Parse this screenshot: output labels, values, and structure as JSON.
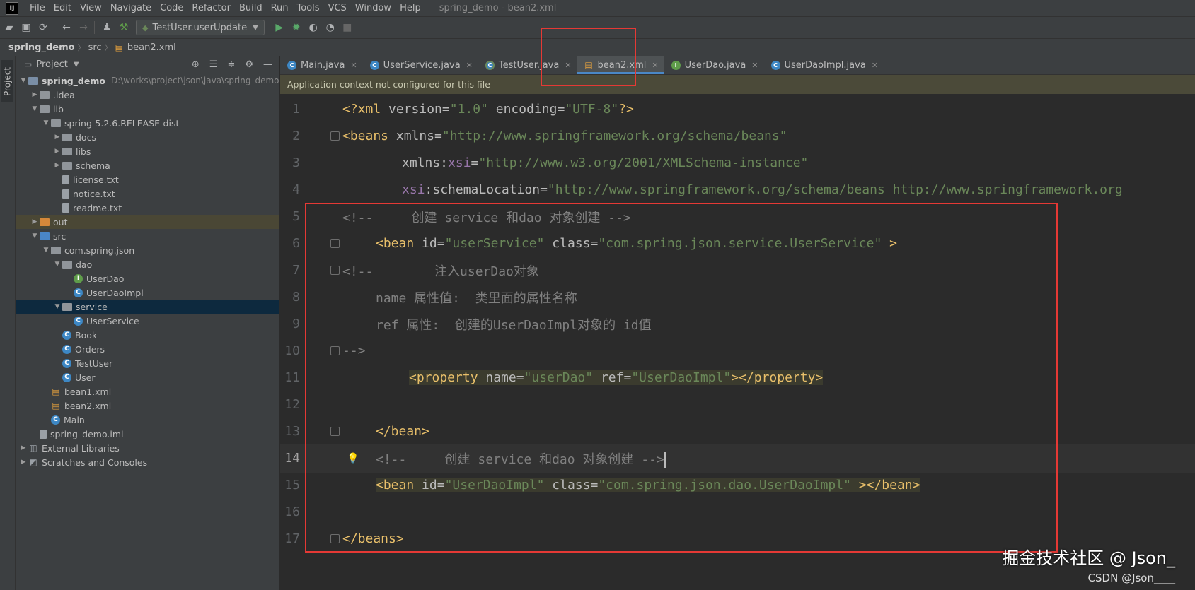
{
  "menubar": {
    "logo": "IJ",
    "items": [
      "File",
      "Edit",
      "View",
      "Navigate",
      "Code",
      "Refactor",
      "Build",
      "Run",
      "Tools",
      "VCS",
      "Window",
      "Help"
    ],
    "window_title": "spring_demo - bean2.xml"
  },
  "toolbar": {
    "run_config": "TestUser.userUpdate"
  },
  "breadcrumb": {
    "project": "spring_demo",
    "folder": "src",
    "file": "bean2.xml"
  },
  "left_strip": {
    "project_tab": "Project"
  },
  "project_panel": {
    "title": "Project",
    "tree": [
      {
        "label": "spring_demo",
        "path": "D:\\works\\project\\json\\java\\spring_demo"
      },
      {
        "label": ".idea"
      },
      {
        "label": "lib"
      },
      {
        "label": "spring-5.2.6.RELEASE-dist"
      },
      {
        "label": "docs"
      },
      {
        "label": "libs"
      },
      {
        "label": "schema"
      },
      {
        "label": "license.txt"
      },
      {
        "label": "notice.txt"
      },
      {
        "label": "readme.txt"
      },
      {
        "label": "out"
      },
      {
        "label": "src"
      },
      {
        "label": "com.spring.json"
      },
      {
        "label": "dao"
      },
      {
        "label": "UserDao"
      },
      {
        "label": "UserDaoImpl"
      },
      {
        "label": "service"
      },
      {
        "label": "UserService"
      },
      {
        "label": "Book"
      },
      {
        "label": "Orders"
      },
      {
        "label": "TestUser"
      },
      {
        "label": "User"
      },
      {
        "label": "bean1.xml"
      },
      {
        "label": "bean2.xml"
      },
      {
        "label": "Main"
      },
      {
        "label": "spring_demo.iml"
      },
      {
        "label": "External Libraries"
      },
      {
        "label": "Scratches and Consoles"
      }
    ]
  },
  "editor": {
    "tabs": [
      {
        "label": "Main.java"
      },
      {
        "label": "UserService.java"
      },
      {
        "label": "TestUser.java"
      },
      {
        "label": "bean2.xml"
      },
      {
        "label": "UserDao.java"
      },
      {
        "label": "UserDaoImpl.java"
      }
    ],
    "notification": "Application context not configured for this file",
    "line_numbers": [
      "1",
      "2",
      "3",
      "4",
      "5",
      "6",
      "7",
      "8",
      "9",
      "10",
      "11",
      "12",
      "13",
      "14",
      "15",
      "16",
      "17"
    ],
    "code": {
      "l1": {
        "a": "<?xml ",
        "b": "version",
        "c": "=",
        "d": "\"1.0\"",
        "e": " encoding",
        "f": "=",
        "g": "\"UTF-8\"",
        "h": "?>"
      },
      "l2": {
        "a": "<beans ",
        "b": "xmlns",
        "c": "=",
        "d": "\"http://www.springframework.org/schema/beans\""
      },
      "l3": {
        "a": "xmlns:",
        "b": "xsi",
        "c": "=",
        "d": "\"http://www.w3.org/2001/XMLSchema-instance\""
      },
      "l4": {
        "a": "xsi",
        "b": ":schemaLocation",
        "c": "=",
        "d": "\"http://www.springframework.org/schema/beans http://www.springframework.org"
      },
      "l5": "<!--     创建 service 和dao 对象创建 -->",
      "l6": {
        "a": "<bean ",
        "b": "id",
        "c": "=",
        "d": "\"userService\"",
        "e": " class",
        "f": "=",
        "g": "\"com.spring.json.service.UserService\"",
        "h": " >"
      },
      "l7": "<!--        注入userDao对象",
      "l8": "name 属性值:  类里面的属性名称",
      "l9": "ref 属性:  创建的UserDaoImpl对象的 id值",
      "l10": "-->",
      "l11": {
        "a": "<property ",
        "b": "name",
        "c": "=",
        "d": "\"userDao\"",
        "e": " ref",
        "f": "=",
        "g": "\"UserDaoImpl\"",
        "h": "></property>"
      },
      "l13": "</bean>",
      "l14": "<!--     创建 service 和dao 对象创建 -->",
      "l15": {
        "a": "<bean ",
        "b": "id",
        "c": "=",
        "d": "\"UserDaoImpl\"",
        "e": " class",
        "f": "=",
        "g": "\"com.spring.json.dao.UserDaoImpl\"",
        "h": " ></bean>"
      },
      "l17": "</beans>"
    }
  },
  "watermark": {
    "main": "掘金技术社区 @ Json_",
    "small": "CSDN @Json____"
  },
  "colors": {
    "annotation": "#e53935",
    "tag": "#e8bf6a",
    "value": "#6a8759",
    "comment": "#808080",
    "selection": "#0d293e"
  }
}
